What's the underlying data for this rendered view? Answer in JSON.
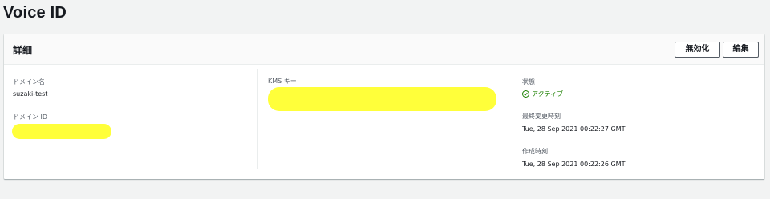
{
  "page": {
    "title": "Voice ID"
  },
  "details": {
    "title": "詳細",
    "buttons": {
      "disable": "無効化",
      "edit": "編集"
    },
    "domain_name": {
      "label": "ドメイン名",
      "value": "suzaki-test"
    },
    "domain_id": {
      "label": "ドメイン ID"
    },
    "kms_key": {
      "label": "KMS キー"
    },
    "status": {
      "label": "状態",
      "value": "アクティブ"
    },
    "last_updated": {
      "label": "最終変更時刻",
      "value": "Tue, 28 Sep 2021 00:22:27 GMT"
    },
    "created": {
      "label": "作成時刻",
      "value": "Tue, 28 Sep 2021 00:22:26 GMT"
    }
  },
  "colors": {
    "redaction": "#ffff3a",
    "status_active": "#1d8102"
  }
}
